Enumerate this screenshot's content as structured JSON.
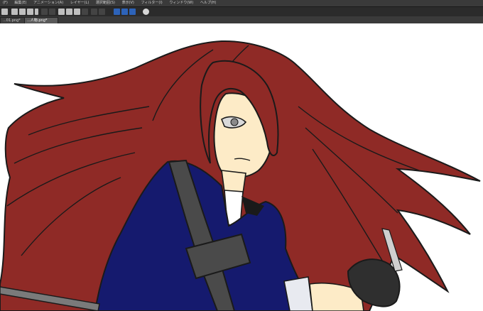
{
  "menu": {
    "items": [
      {
        "label": "(F)"
      },
      {
        "label": "編集(E)"
      },
      {
        "label": "アニメーション(A)"
      },
      {
        "label": "レイヤー(L)"
      },
      {
        "label": "選択範囲(S)"
      },
      {
        "label": "表示(V)"
      },
      {
        "label": "フィルター(I)"
      },
      {
        "label": "ウィンドウ(W)"
      },
      {
        "label": "ヘルプ(H)"
      }
    ]
  },
  "toolbar": {
    "buttons": [
      {
        "icon": "menu-icon"
      },
      {
        "icon": "new-icon"
      },
      {
        "icon": "open-icon"
      },
      {
        "icon": "save-icon"
      },
      {
        "icon": "color-icon"
      },
      {
        "icon": "undo-icon"
      },
      {
        "icon": "redo-icon"
      },
      {
        "icon": "clear-icon"
      },
      {
        "icon": "fill-icon"
      },
      {
        "icon": "transform-icon"
      },
      {
        "icon": "deselect-icon"
      },
      {
        "icon": "invert-icon"
      },
      {
        "icon": "select-icon"
      },
      {
        "icon": "lasso-icon"
      },
      {
        "icon": "paint-bucket-icon"
      },
      {
        "icon": "brush-icon"
      },
      {
        "icon": "help-icon"
      }
    ]
  },
  "tabs": [
    {
      "label": "...01.png*"
    },
    {
      "label": "...人物.png*"
    }
  ],
  "colors": {
    "hair": "#8f2a26",
    "outline": "#1a1a1a",
    "jacket": "#151a6e",
    "strap": "#4a4a4a",
    "skin": "#fdebc7",
    "glove": "#2f2f2f"
  }
}
